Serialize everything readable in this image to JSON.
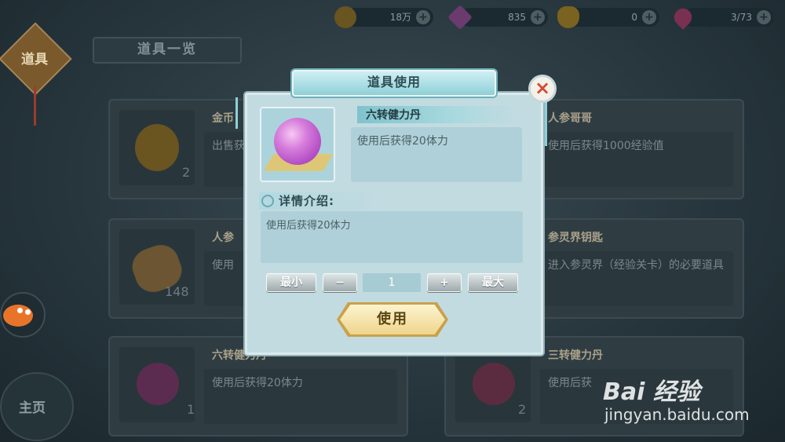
{
  "currency": [
    {
      "value": "18万",
      "icon": "coin-icon",
      "color": "#6a5420"
    },
    {
      "value": "835",
      "icon": "purple-crystal-icon",
      "color": "#6b3b6e"
    },
    {
      "value": "0",
      "icon": "gold-ingot-icon",
      "color": "#7a6220"
    },
    {
      "value": "3/73",
      "icon": "pink-gem-icon",
      "color": "#7a3050"
    }
  ],
  "left_rail": {
    "tag": "道具",
    "home": "主页"
  },
  "list_tab": "道具一览",
  "items": [
    {
      "name": "金币",
      "desc": "出售获",
      "count": "2"
    },
    {
      "name": "人参哥哥",
      "desc": "使用后获得1000经验值",
      "count": ""
    },
    {
      "name": "人参",
      "desc": "使用",
      "count": "148"
    },
    {
      "name": "参灵界钥匙",
      "desc": "进入参灵界（经验关卡）的必要道具",
      "count": ""
    },
    {
      "name": "六转健力丹",
      "desc": "使用后获得20体力",
      "count": "1"
    },
    {
      "name": "三转健力丹",
      "desc": "使用后获",
      "count": "2"
    }
  ],
  "dialog": {
    "title": "道具使用",
    "close": "×",
    "item_name": "六转健力丹",
    "item_short": "使用后获得20体力",
    "detail_label": "详情介绍:",
    "detail_text": "使用后获得20体力",
    "btn_min": "最小",
    "btn_minus": "−",
    "quantity": "1",
    "btn_plus": "+",
    "btn_max": "最大",
    "use": "使用"
  },
  "watermark": {
    "logo": "Bai 经验",
    "url": "jingyan.baidu.com"
  }
}
